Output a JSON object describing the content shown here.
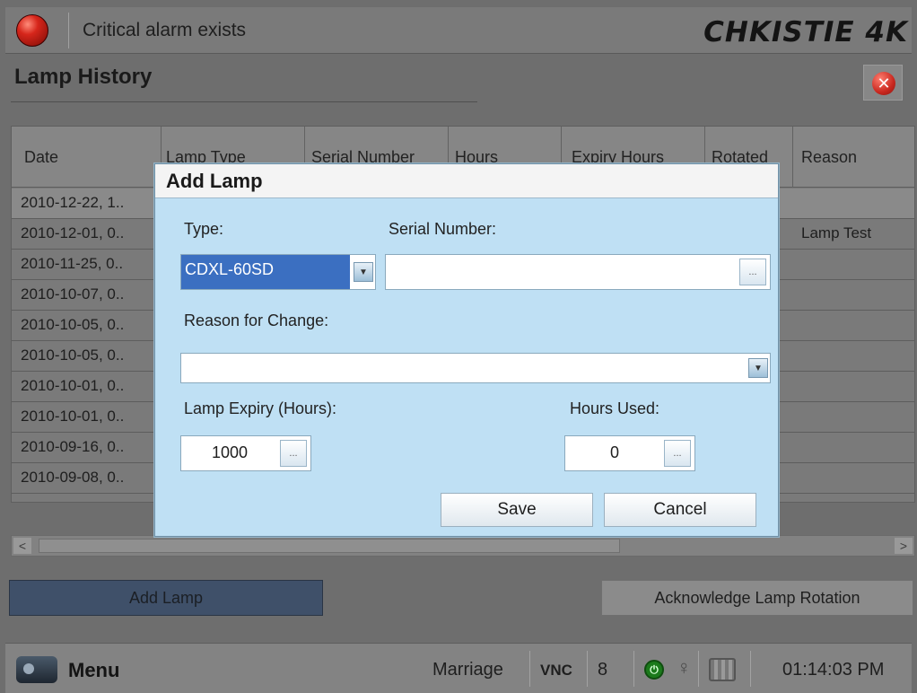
{
  "topbar": {
    "alarm_text": "Critical alarm exists",
    "brand": "CHKISTIE 4K"
  },
  "page": {
    "title": "Lamp History"
  },
  "table": {
    "columns": [
      "Date",
      "Lamp Type",
      "Serial Number",
      "Hours",
      "Expiry Hours",
      "Rotated",
      "Reason"
    ],
    "rows": [
      {
        "date": "2010-12-22, 1..",
        "reason": ""
      },
      {
        "date": "2010-12-01, 0..",
        "reason": "Lamp Test"
      },
      {
        "date": "2010-11-25, 0..",
        "reason": ""
      },
      {
        "date": "2010-10-07, 0..",
        "reason": ""
      },
      {
        "date": "2010-10-05, 0..",
        "reason": ""
      },
      {
        "date": "2010-10-05, 0..",
        "reason": ""
      },
      {
        "date": "2010-10-01, 0..",
        "reason": ""
      },
      {
        "date": "2010-10-01, 0..",
        "reason": ""
      },
      {
        "date": "2010-09-16, 0..",
        "reason": ""
      },
      {
        "date": "2010-09-08, 0..",
        "reason": ""
      }
    ]
  },
  "buttons": {
    "add_lamp": "Add Lamp",
    "acknowledge": "Acknowledge Lamp Rotation"
  },
  "statusbar": {
    "menu": "Menu",
    "marriage": "Marriage",
    "vnc": "VNC",
    "channel": "8",
    "time": "01:14:03 PM"
  },
  "dialog": {
    "title": "Add Lamp",
    "type_label": "Type:",
    "type_value": "CDXL-60SD",
    "serial_label": "Serial Number:",
    "serial_value": "",
    "reason_label": "Reason for Change:",
    "reason_value": "",
    "expiry_label": "Lamp Expiry (Hours):",
    "expiry_value": "1000",
    "hours_used_label": "Hours Used:",
    "hours_used_value": "0",
    "dots": "...",
    "save": "Save",
    "cancel": "Cancel"
  }
}
